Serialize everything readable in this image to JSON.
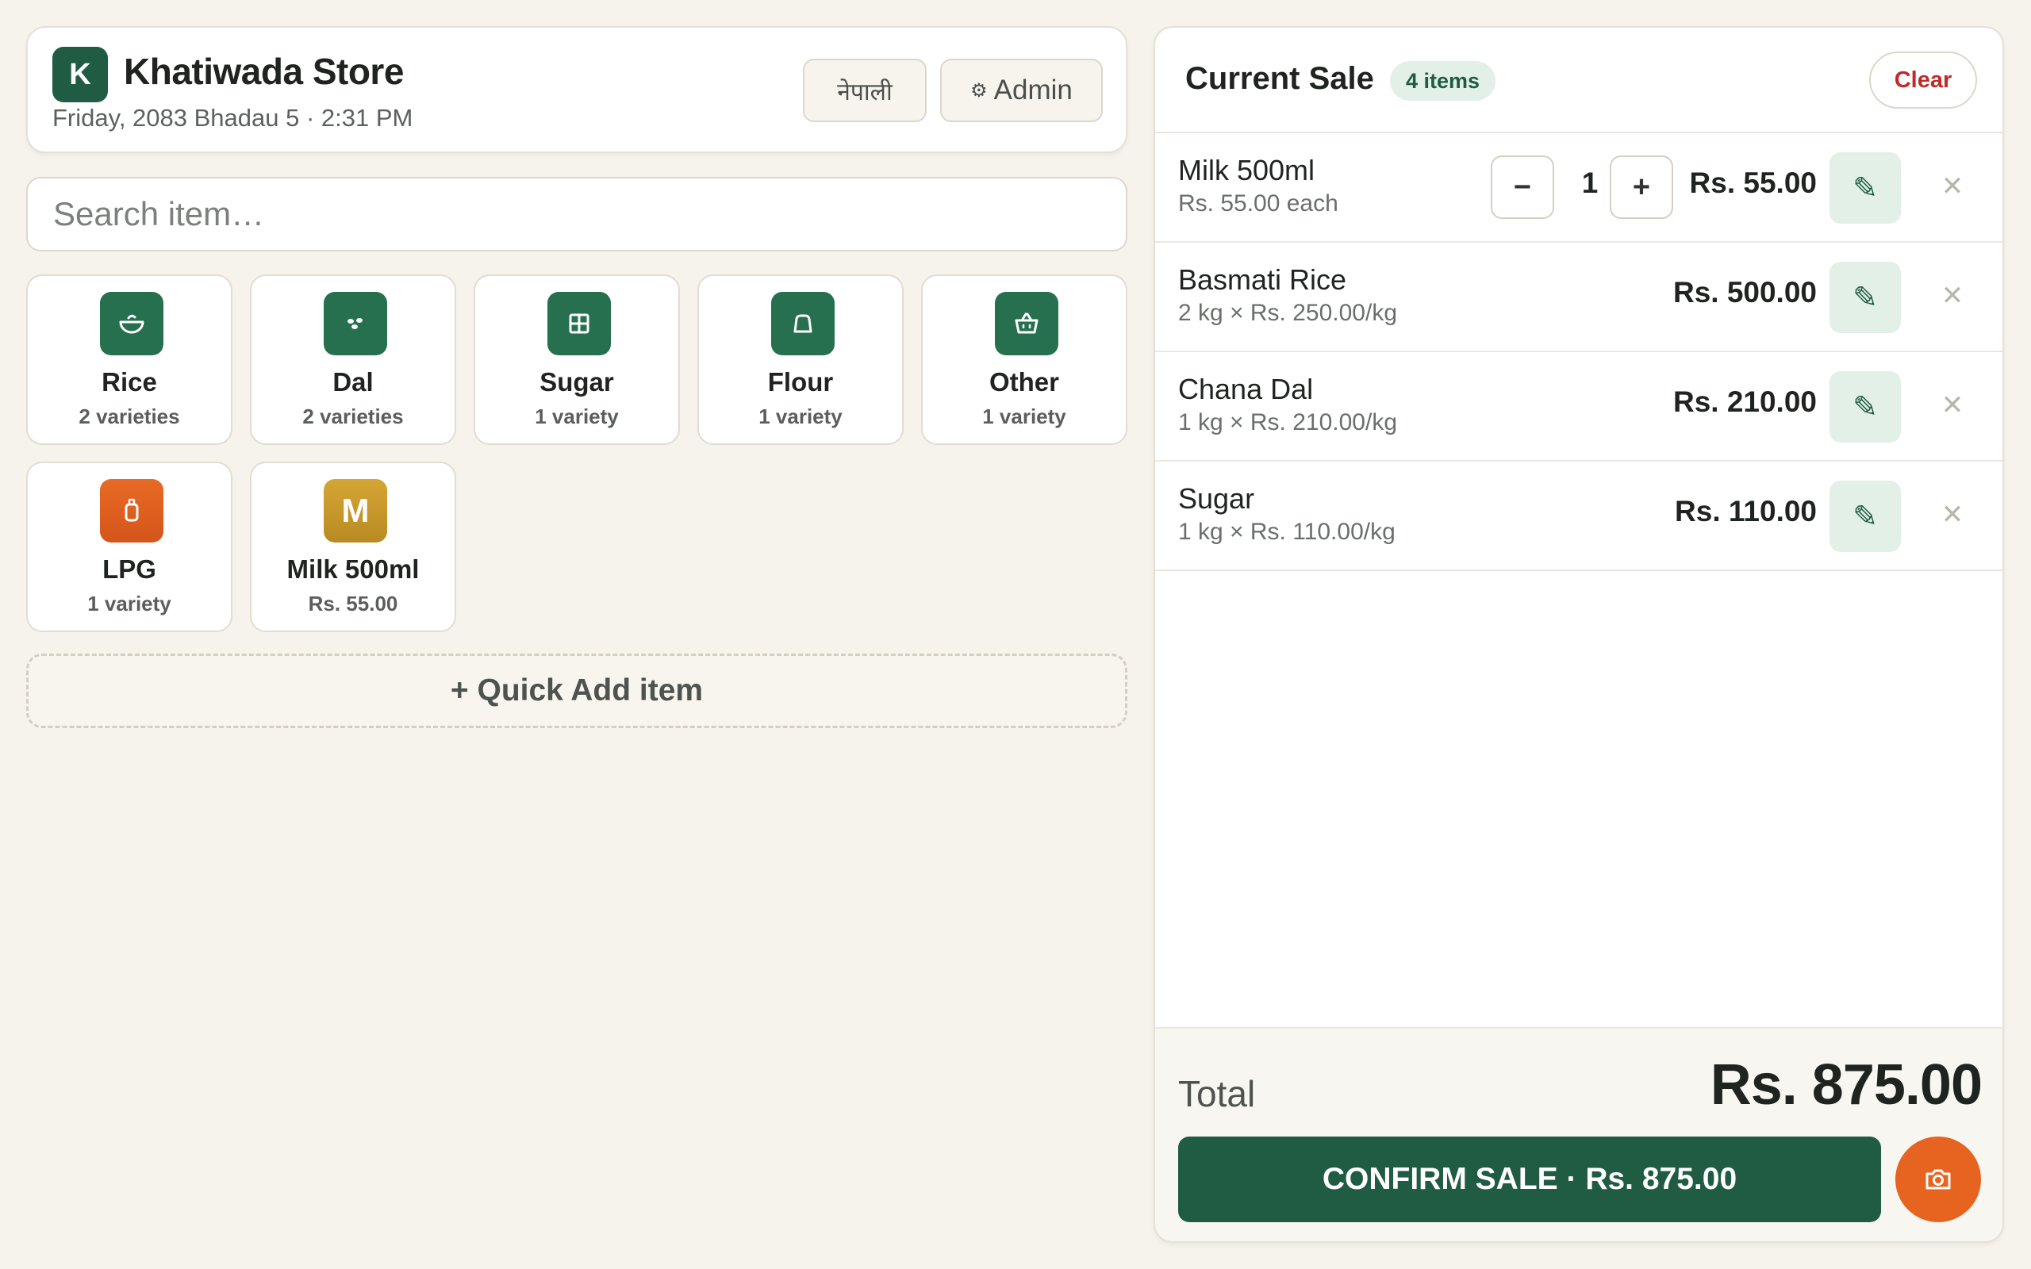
{
  "store": {
    "logo_letter": "K",
    "name": "Khatiwada Store",
    "date": "Friday, 2083 Bhadau 5 · 2:31 PM",
    "language_button": "नेपाली",
    "admin_icon": "⚙",
    "admin_button": "Admin"
  },
  "search": {
    "placeholder": "Search item…"
  },
  "categories": [
    {
      "name": "Rice",
      "sub": "2 varieties",
      "icon": "bowl-icon"
    },
    {
      "name": "Dal",
      "sub": "2 varieties",
      "icon": "lentils-icon"
    },
    {
      "name": "Sugar",
      "sub": "1 variety",
      "icon": "cube-icon"
    },
    {
      "name": "Flour",
      "sub": "1 variety",
      "icon": "flour-sack-icon"
    },
    {
      "name": "Other",
      "sub": "1 variety",
      "icon": "basket-icon"
    },
    {
      "name": "LPG",
      "sub": "1 variety",
      "icon": "gas-cylinder-icon"
    },
    {
      "name": "Milk 500ml",
      "sub": "Rs. 55.00",
      "icon_letter": "M"
    }
  ],
  "quick_add": "+ Quick Add item",
  "sale": {
    "title": "Current Sale",
    "count_badge": "4 items",
    "clear_label": "Clear",
    "items": [
      {
        "name": "Milk 500ml",
        "detail": "Rs. 55.00 each",
        "price": "Rs. 55.00",
        "qty": "1",
        "minus": "−",
        "plus": "+"
      },
      {
        "name": "Basmati Rice",
        "detail": "2 kg × Rs. 250.00/kg",
        "price": "Rs. 500.00"
      },
      {
        "name": "Chana Dal",
        "detail": "1 kg × Rs. 210.00/kg",
        "price": "Rs. 210.00"
      },
      {
        "name": "Sugar",
        "detail": "1 kg × Rs. 110.00/kg",
        "price": "Rs. 110.00"
      }
    ],
    "edit_glyph": "✎",
    "remove_glyph": "✕",
    "total_label": "Total",
    "total_value": "Rs. 875.00",
    "confirm_label": "CONFIRM SALE · Rs. 875.00"
  },
  "colors": {
    "brand_green": "#1f5c43",
    "accent_orange": "#e6641f",
    "danger_red": "#c22a2a",
    "background": "#f6f3ec"
  }
}
